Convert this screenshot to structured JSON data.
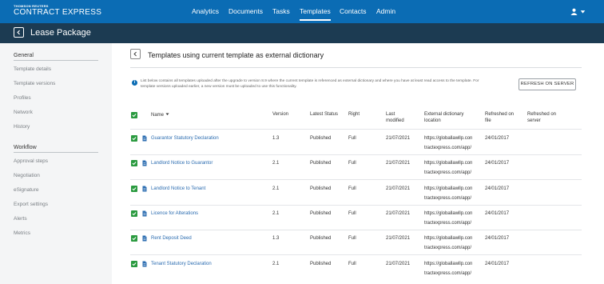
{
  "brand": {
    "top": "THOMSON REUTERS",
    "name": "CONTRACT EXPRESS"
  },
  "nav": [
    "Analytics",
    "Documents",
    "Tasks",
    "Templates",
    "Contacts",
    "Admin"
  ],
  "nav_active": "Templates",
  "page_title": "Lease Package",
  "sidebar": {
    "general_heading": "General",
    "general_items": [
      "Template details",
      "Template versions",
      "Profiles",
      "Network",
      "History"
    ],
    "workflow_heading": "Workflow",
    "workflow_items": [
      "Approval steps",
      "Negotiation",
      "eSignature",
      "Export settings",
      "Alerts",
      "Metrics"
    ]
  },
  "main": {
    "title": "Templates using current template as external dictionary",
    "info": "List below contains all templates uploaded after the upgrade to version 8.9 where the current template is referenced as external dictionary and where you have at least read access to the template. For template versions uploaded earlier, a new version must be uploaded to use this functionality.",
    "refresh_label": "REFRESH ON SERVER",
    "columns": {
      "name": "Name",
      "version": "Version",
      "status": "Latest Status",
      "right": "Right",
      "modified_1": "Last",
      "modified_2": "modified",
      "location_1": "External dictionary",
      "location_2": "location",
      "refreshed_file_1": "Refreshed on",
      "refreshed_file_2": "file",
      "refreshed_server_1": "Refreshed on",
      "refreshed_server_2": "server"
    },
    "rows": [
      {
        "name": "Guarantor Statutory Declaration",
        "version": "1.3",
        "status": "Published",
        "right": "Full",
        "modified": "21/07/2021",
        "loc1": "https://globallawllp.con",
        "loc2": "tractexpress.com/app/",
        "refreshed_file": "24/01/2017",
        "refreshed_server": ""
      },
      {
        "name": "Landlord Notice to Guarantor",
        "version": "2.1",
        "status": "Published",
        "right": "Full",
        "modified": "21/07/2021",
        "loc1": "https://globallawllp.con",
        "loc2": "tractexpress.com/app/",
        "refreshed_file": "24/01/2017",
        "refreshed_server": ""
      },
      {
        "name": "Landlord Notice to Tenant",
        "version": "2.1",
        "status": "Published",
        "right": "Full",
        "modified": "21/07/2021",
        "loc1": "https://globallawllp.con",
        "loc2": "tractexpress.com/app/",
        "refreshed_file": "24/01/2017",
        "refreshed_server": ""
      },
      {
        "name": "Licence for Alterations",
        "version": "2.1",
        "status": "Published",
        "right": "Full",
        "modified": "21/07/2021",
        "loc1": "https://globallawllp.con",
        "loc2": "tractexpress.com/app/",
        "refreshed_file": "24/01/2017",
        "refreshed_server": ""
      },
      {
        "name": "Rent Deposit Deed",
        "version": "1.3",
        "status": "Published",
        "right": "Full",
        "modified": "21/07/2021",
        "loc1": "https://globallawllp.con",
        "loc2": "tractexpress.com/app/",
        "refreshed_file": "24/01/2017",
        "refreshed_server": ""
      },
      {
        "name": "Tenant Statutory Declaration",
        "version": "2.1",
        "status": "Published",
        "right": "Full",
        "modified": "21/07/2021",
        "loc1": "https://globallawllp.con",
        "loc2": "tractexpress.com/app/",
        "refreshed_file": "24/01/2017",
        "refreshed_server": ""
      }
    ]
  },
  "colors": {
    "topbar": "#0b6cb4",
    "subbar": "#1c3b52",
    "checkbox": "#2a9a3f",
    "link": "#2b6cb0"
  },
  "icons": [
    "user-icon",
    "caret-down-icon",
    "back-arrow-icon",
    "info-icon",
    "checkbox-checked-icon",
    "file-icon",
    "sort-arrow-icon"
  ]
}
